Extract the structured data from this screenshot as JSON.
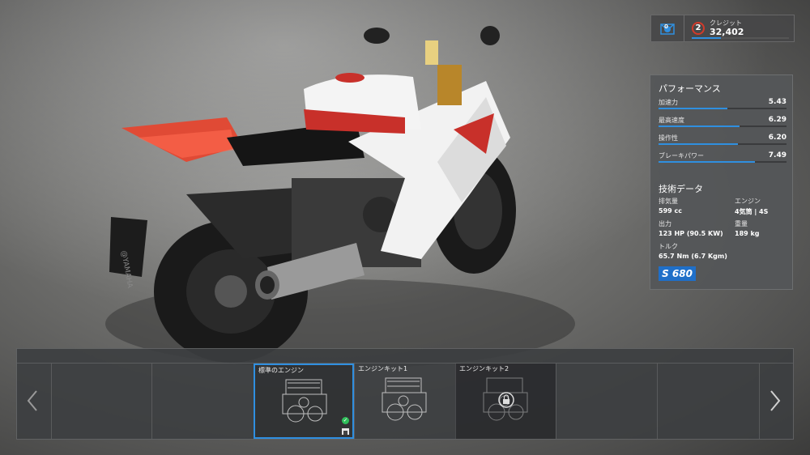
{
  "topbar": {
    "level": "2",
    "credit_label": "クレジット",
    "credit_value": "32,402",
    "inbox_icon": "mail-badge-icon",
    "inbox_count": "0"
  },
  "performance": {
    "title": "パフォーマンス",
    "stats": [
      {
        "label": "加速力",
        "value": "5.43",
        "fill": 0.54
      },
      {
        "label": "最高速度",
        "value": "6.29",
        "fill": 0.63
      },
      {
        "label": "操作性",
        "value": "6.20",
        "fill": 0.62
      },
      {
        "label": "ブレーキパワー",
        "value": "7.49",
        "fill": 0.75
      }
    ]
  },
  "specs": {
    "title": "技術データ",
    "displacement_label": "排気量",
    "displacement": "599 cc",
    "engine_label": "エンジン",
    "engine": "4気筒 | 4S",
    "power_label": "出力",
    "power": "123 HP (90.5 KW)",
    "weight_label": "重量",
    "weight": "189 kg",
    "torque_label": "トルク",
    "torque": "65.7 Nm (6.7 Kgm)",
    "class": "S 680"
  },
  "engines": {
    "slots": [
      {
        "label": "標準のエンジン",
        "state": "selected",
        "owned": true
      },
      {
        "label": "エンジンキット1",
        "state": "available"
      },
      {
        "label": "エンジンキット2",
        "state": "locked"
      }
    ],
    "prev_icon": "chevron-left-icon",
    "next_icon": "chevron-right-icon"
  },
  "colors": {
    "accent": "#2f8fe0",
    "bike_red": "#d83a2a",
    "selected_border": "#2f8fe0"
  }
}
